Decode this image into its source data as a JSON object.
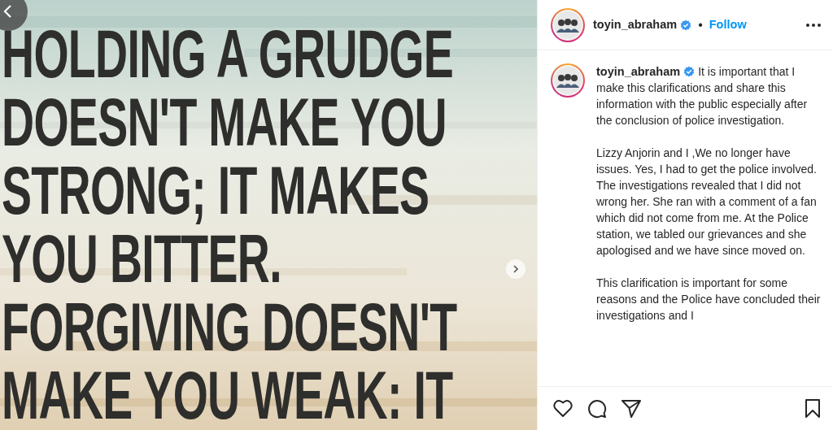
{
  "post_image": {
    "lines": [
      "HOLDING A GRUDGE",
      "DOESN'T MAKE YOU",
      "STRONG; IT MAKES",
      "YOU BITTER.",
      "FORGIVING DOESN'T",
      "MAKE YOU WEAK: IT"
    ]
  },
  "header": {
    "username": "toyin_abraham",
    "verified": true,
    "separator": "•",
    "follow": "Follow"
  },
  "caption": {
    "username": "toyin_abraham",
    "verified": true,
    "paragraphs": [
      "It is important that I make this clarifications and share this information with the public especially after the conclusion of police investigation.",
      "Lizzy Anjorin and I ,We no longer have issues. Yes, I had to get the police involved. The investigations revealed that I did not wrong her. She ran with a comment of a fan which did not come from me. At the Police station, we tabled our grievances and she apologised and we have since moved on.",
      "This clarification is important for some reasons and the Police have concluded their investigations and I"
    ]
  }
}
